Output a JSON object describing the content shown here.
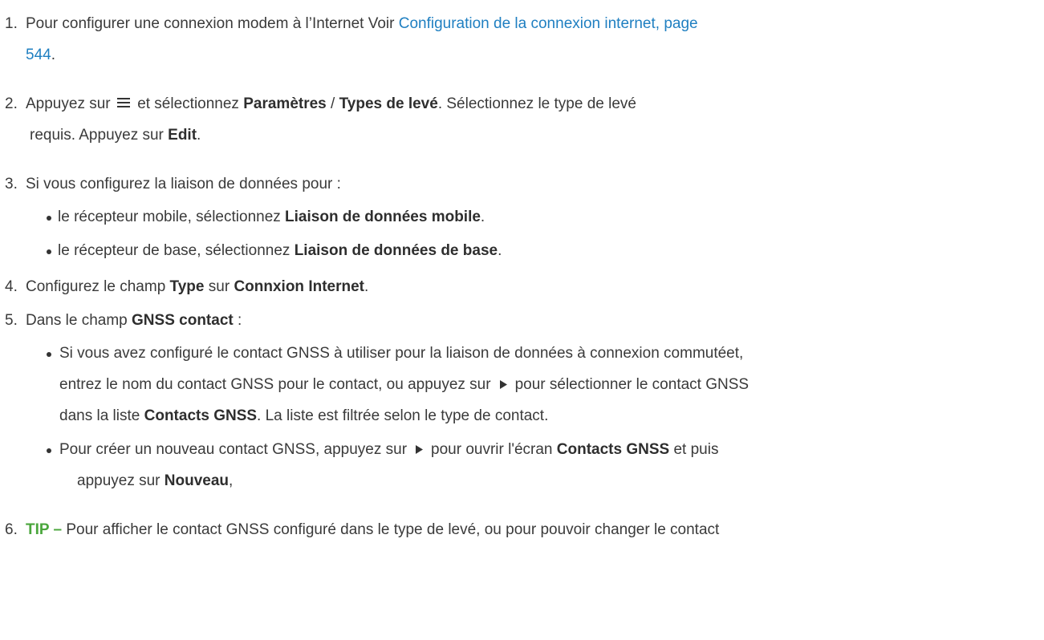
{
  "steps": {
    "s1": {
      "num": "1.",
      "text": "Pour configurer une connexion modem à l’Internet Voir ",
      "link_line1": "Configuration de la connexion internet, page",
      "link_line2": "544",
      "tail": "."
    },
    "s2": {
      "num": "2.",
      "a": "Appuyez sur",
      "b": "et sélectionnez ",
      "b_bold1": "Paramètres",
      "sep": " / ",
      "b_bold2": "Types de levé",
      "c": ". Sélectionnez le type de levé",
      "d": "requis. Appuyez sur ",
      "d_bold": "Edit",
      "d_tail": "."
    },
    "s3": {
      "num": "3.",
      "text": "Si vous configurez la liaison de données pour :",
      "bullet1_a": "le récepteur mobile, sélectionnez ",
      "bullet1_bold": "Liaison de données mobile",
      "bullet1_tail": ".",
      "bullet2_a": "le récepteur de base, sélectionnez ",
      "bullet2_bold": "Liaison de données de base",
      "bullet2_tail": "."
    },
    "s4": {
      "num": "4.",
      "a": "Configurez le champ ",
      "bold1": "Type",
      "b": " sur ",
      "bold2": "Connxion Internet",
      "tail": "."
    },
    "s5": {
      "num": "5.",
      "a": "Dans le champ ",
      "bold": "GNSS contact",
      "tail": " :",
      "bullet1_line1": "Si vous avez configuré le contact GNSS à utiliser pour la liaison de données à connexion commutéet,",
      "bullet1_line2_a": "entrez le nom du contact GNSS pour le contact, ou appuyez sur",
      "bullet1_line2_b": "pour sélectionner le contact GNSS",
      "bullet1_line3_a": "dans la liste ",
      "bullet1_line3_bold": "Contacts GNSS",
      "bullet1_line3_b": ". La liste est filtrée selon le type de contact.",
      "bullet2_line1_a": "Pour créer un nouveau contact GNSS, appuyez sur",
      "bullet2_line1_b": "pour ouvrir l'écran ",
      "bullet2_line1_bold": "Contacts GNSS",
      "bullet2_line1_c": " et puis",
      "bullet2_line2_a": "appuyez sur ",
      "bullet2_line2_bold": "Nouveau",
      "bullet2_line2_tail": ","
    },
    "s6": {
      "num": "6.",
      "tip_label": "TIP –",
      "text": " Pour afficher le contact GNSS configuré dans le type de levé, ou pour pouvoir changer le contact"
    }
  },
  "icons": {
    "menu": "hamburger-menu-icon",
    "select": "triangle-right-icon"
  },
  "colors": {
    "text": "#3a3a3a",
    "link": "#1f7fc1",
    "tip": "#4aa63c"
  }
}
